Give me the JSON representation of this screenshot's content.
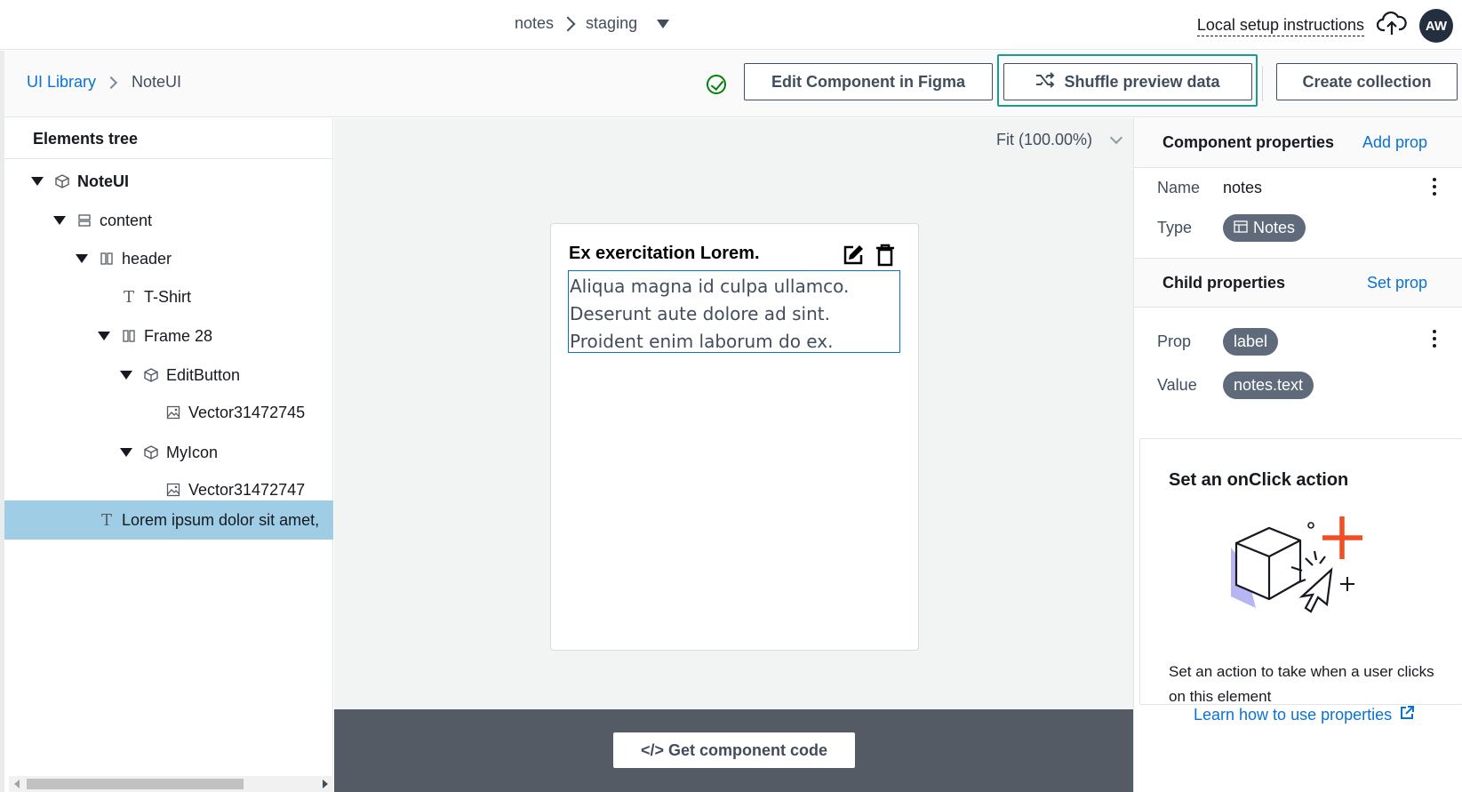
{
  "topbar": {
    "app": "notes",
    "env": "staging",
    "local_setup": "Local setup instructions",
    "avatar": "AW"
  },
  "subbar": {
    "breadcrumb_root": "UI Library",
    "breadcrumb_current": "NoteUI",
    "edit_figma": "Edit Component in Figma",
    "shuffle": "Shuffle preview data",
    "create_collection": "Create collection"
  },
  "tree": {
    "title": "Elements tree",
    "items": [
      {
        "label": "NoteUI",
        "type": "component",
        "bold": true
      },
      {
        "label": "content",
        "type": "stack"
      },
      {
        "label": "header",
        "type": "flex"
      },
      {
        "label": "T-Shirt",
        "type": "text"
      },
      {
        "label": "Frame 28",
        "type": "flex"
      },
      {
        "label": "EditButton",
        "type": "component"
      },
      {
        "label": "Vector31472745",
        "type": "image"
      },
      {
        "label": "MyIcon",
        "type": "component"
      },
      {
        "label": "Vector31472747",
        "type": "image"
      },
      {
        "label": "Lorem ipsum dolor sit amet,",
        "type": "text",
        "selected": true
      }
    ]
  },
  "canvas": {
    "zoom": "Fit (100.00%)",
    "card_title": "Ex exercitation Lorem.",
    "card_lines": [
      "Aliqua magna id culpa ullamco.",
      "Deserunt aute dolore ad sint.",
      "Proident enim laborum do ex."
    ],
    "code_button": "</> Get component code"
  },
  "properties": {
    "component_header": "Component properties",
    "add_prop": "Add prop",
    "name_label": "Name",
    "name_value": "notes",
    "type_label": "Type",
    "type_value": "Notes",
    "child_header": "Child properties",
    "set_prop": "Set prop",
    "prop_label": "Prop",
    "prop_value": "label",
    "value_label": "Value",
    "value_value": "notes.text",
    "action_title": "Set an onClick action",
    "action_desc": "Set an action to take when a user clicks on this element",
    "learn": "Learn how to use properties"
  },
  "colors": {
    "link": "#0972d3",
    "selected_row": "#9fcde6",
    "focus_ring": "#1a9c8a",
    "success": "#037f0c",
    "pill": "#5f6b7a",
    "code_bar": "#545b64",
    "accent_plus": "#f04e23"
  }
}
